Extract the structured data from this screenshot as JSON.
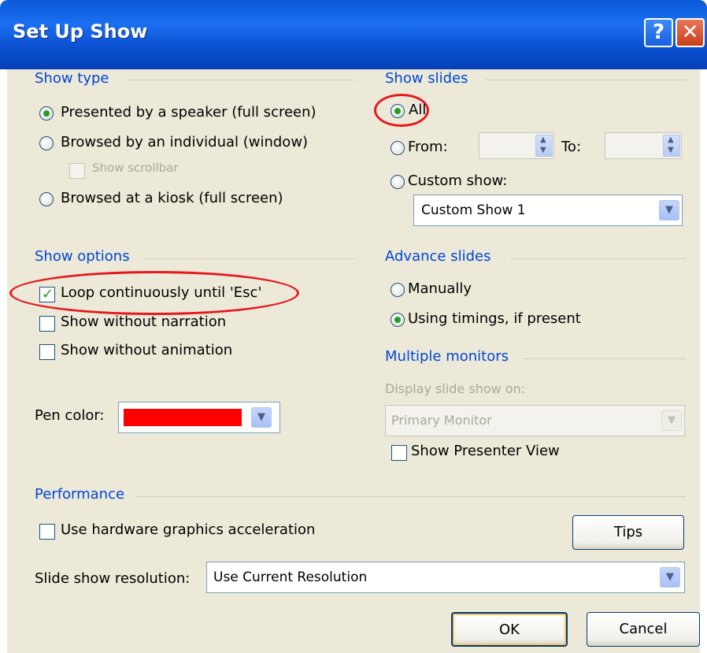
{
  "window": {
    "title": "Set Up Show",
    "help_glyph": "?",
    "close_glyph": "✕"
  },
  "show_type": {
    "heading": "Show type",
    "options": [
      {
        "label": "Presented by a speaker (full screen)",
        "selected": true
      },
      {
        "label": "Browsed by an individual (window)",
        "selected": false
      },
      {
        "label": "Browsed at a kiosk (full screen)",
        "selected": false
      }
    ],
    "scrollbar_label": "Show scrollbar"
  },
  "show_slides": {
    "heading": "Show slides",
    "all_label": "All",
    "from_label": "From:",
    "to_label": "To:",
    "from_value": "",
    "to_value": "",
    "custom_label": "Custom show:",
    "custom_value": "Custom Show 1"
  },
  "show_options": {
    "heading": "Show options",
    "loop_label": "Loop continuously until 'Esc'",
    "loop_checked": true,
    "narration_label": "Show without narration",
    "animation_label": "Show without animation",
    "pen_label": "Pen color:",
    "pen_color": "#ff0000"
  },
  "advance_slides": {
    "heading": "Advance slides",
    "manual_label": "Manually",
    "timings_label": "Using timings, if present",
    "selected": "timings"
  },
  "multiple_monitors": {
    "heading": "Multiple monitors",
    "display_label": "Display slide show on:",
    "display_value": "Primary Monitor",
    "presenter_label": "Show Presenter View"
  },
  "performance": {
    "heading": "Performance",
    "hw_label": "Use hardware graphics acceleration",
    "tips_label": "Tips",
    "resolution_label": "Slide show resolution:",
    "resolution_value": "Use Current Resolution"
  },
  "footer": {
    "ok_label": "OK",
    "cancel_label": "Cancel"
  },
  "colors": {
    "titlebar": "#0a5ad8",
    "group_heading": "#0046d5",
    "annotation": "#e5191f",
    "dialog_face": "#ece9d8"
  }
}
